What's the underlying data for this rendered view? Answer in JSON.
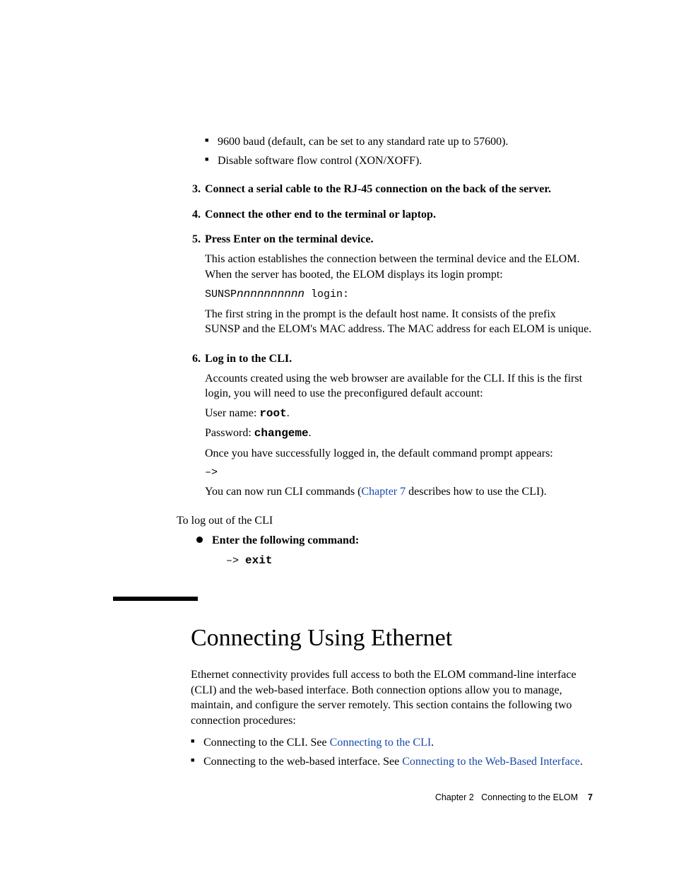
{
  "top_bullets": [
    "9600 baud (default, can be set to any standard rate up to 57600).",
    "Disable software flow control (XON/XOFF)."
  ],
  "steps": {
    "s3": {
      "num": "3.",
      "title": "Connect a serial cable to the RJ-45 connection on the back of the server."
    },
    "s4": {
      "num": "4.",
      "title": "Connect the other end to the terminal or laptop."
    },
    "s5": {
      "num": "5.",
      "title": "Press Enter on the terminal device.",
      "p1": "This action establishes the connection between the terminal device and the ELOM. When the server has booted, the ELOM displays its login prompt:",
      "code_prefix": "SUNSP",
      "code_var": "nnnnnnnnnn",
      "code_suffix": " login:",
      "p2": "The first string in the prompt is the default host name. It consists of the prefix SUNSP and the ELOM's MAC address. The MAC address for each ELOM is unique."
    },
    "s6": {
      "num": "6.",
      "title": "Log in to the CLI.",
      "p1": "Accounts created using the web browser are available for the CLI. If this is the first login, you will need to use the preconfigured default account:",
      "user_label": "User name: ",
      "user_val": "root",
      "pw_label": "Password: ",
      "pw_val": "changeme",
      "p2": "Once you have successfully logged in, the default command prompt appears:",
      "prompt": "–>",
      "p3a": "You can now run CLI commands (",
      "p3link": "Chapter 7",
      "p3b": " describes how to use the CLI)."
    }
  },
  "logout_intro": "To log out of the CLI",
  "logout_step": "Enter the following command:",
  "exit_prompt": "–> ",
  "exit_cmd": "exit",
  "section_title": "Connecting Using Ethernet",
  "section_intro": "Ethernet connectivity provides full access to both the ELOM command-line interface (CLI) and the web-based interface. Both connection options allow you to manage, maintain, and configure the server remotely. This section contains the following two connection procedures:",
  "sec_bullets": {
    "b1a": "Connecting to the CLI. See ",
    "b1link": "Connecting to the CLI",
    "b2a": "Connecting to the web-based interface. See ",
    "b2link": "Connecting to the Web-Based Interface"
  },
  "footer": {
    "chapter": "Chapter 2",
    "title": "Connecting to the ELOM",
    "page": "7"
  }
}
